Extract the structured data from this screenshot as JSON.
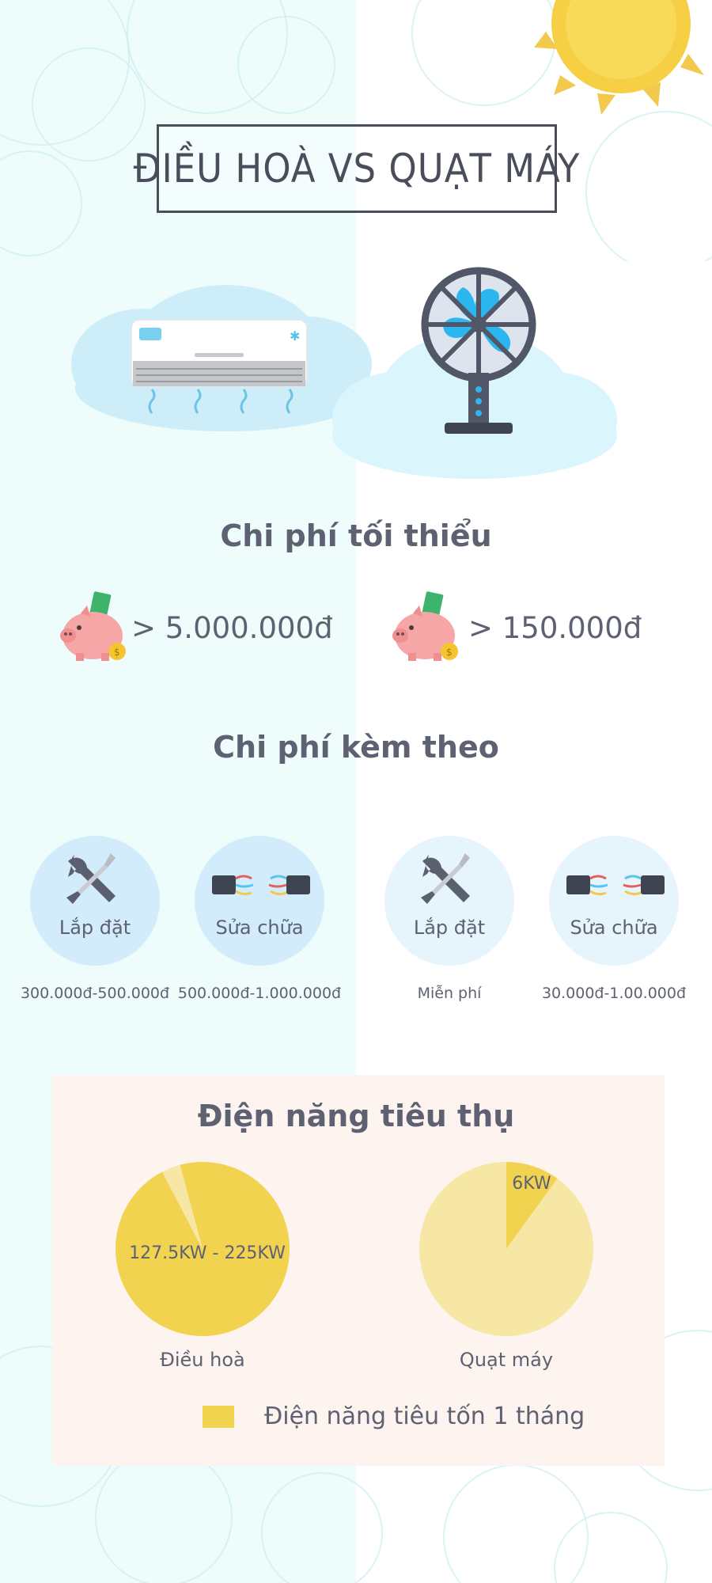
{
  "title": "ĐIỀU HOÀ  VS QUẠT MÁY",
  "sections": {
    "min_cost_title": "Chi phí tối thiểu",
    "extra_cost_title": "Chi phí kèm theo",
    "power_title": "Điện năng tiêu thụ"
  },
  "min_cost": {
    "air_conditioner": "> 5.000.000đ",
    "fan": "> 150.000đ"
  },
  "extra_costs": [
    {
      "label": "Lắp đặt",
      "price": "300.000đ-500.000đ"
    },
    {
      "label": "Sửa chữa",
      "price": "500.000đ-1.000.000đ"
    },
    {
      "label": "Lắp đặt",
      "price": "Miễn phí"
    },
    {
      "label": "Sửa chữa",
      "price": "30.000đ-1.00.000đ"
    }
  ],
  "colors": {
    "left_bg": "#eefcfc",
    "panel_bg": "#fdf3ef",
    "pie_main": "#f1d350",
    "pie_light": "#f6e7a4",
    "text": "#5d6172"
  },
  "chart_data": [
    {
      "type": "pie",
      "title": "Điều hoà",
      "slices": [
        {
          "label": "127.5KW - 225KW",
          "value": 0.965
        },
        {
          "label": "",
          "value": 0.035
        }
      ]
    },
    {
      "type": "pie",
      "title": "Quạt máy",
      "slices": [
        {
          "label": "6KW",
          "value": 0.1
        },
        {
          "label": "",
          "value": 0.9
        }
      ]
    }
  ],
  "legend": {
    "label": "Điện năng tiêu tốn 1 tháng"
  }
}
